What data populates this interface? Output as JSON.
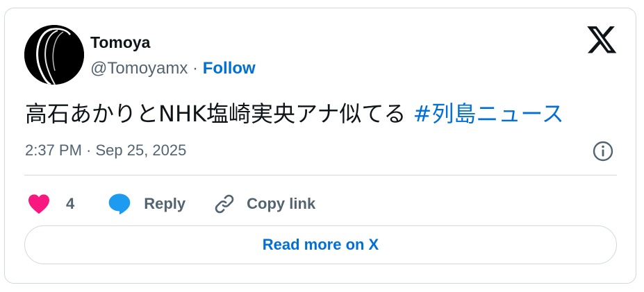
{
  "author": {
    "name": "Tomoya",
    "handle": "@Tomoyamx",
    "separator": " · ",
    "follow_label": "Follow",
    "avatar_icon": "avatar-image"
  },
  "brand": {
    "logo_icon": "x-logo-icon"
  },
  "tweet": {
    "text": "高石あかりとNHK塩崎実央アナ似てる ",
    "hashtag": "#列島ニュース",
    "timestamp": "2:37 PM · Sep 25, 2025",
    "info_icon": "info-icon"
  },
  "actions": {
    "like_count": "4",
    "reply_label": "Reply",
    "copy_link_label": "Copy link"
  },
  "read_more_label": "Read more on X",
  "colors": {
    "accent": "#006fd6",
    "heart": "#f91880",
    "reply_bubble": "#1d9bf0",
    "muted_text": "#536471",
    "border": "#cfd9de"
  }
}
